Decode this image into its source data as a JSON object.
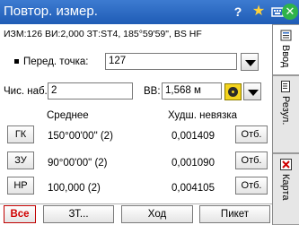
{
  "window": {
    "title": "Повтор. измер."
  },
  "titlebar_icons": {
    "help": "question-mark-icon",
    "favorite": "star-icon",
    "keyboard": "keyboard-icon",
    "close": "close-icon"
  },
  "status_line": "ИЗМ:126  ВИ:2,000  ЗТ:ST4, 185°59'59\", BS НF",
  "backsight": {
    "label": "Перед. точка:",
    "value": "127"
  },
  "sets": {
    "label": "Чис. наб.:",
    "value": "2"
  },
  "target_height": {
    "label": "ВВ:",
    "value": "1,568 м"
  },
  "table": {
    "col_mean": "Среднее",
    "col_worst": "Худш. невязка",
    "rows": [
      {
        "button": "ГК",
        "mean": "150°00'00\" (2)",
        "worst": "0,001409",
        "action": "Отб."
      },
      {
        "button": "ЗУ",
        "mean": "90°00'00\" (2)",
        "worst": "0,001090",
        "action": "Отб."
      },
      {
        "button": "НР",
        "mean": "100,000 (2)",
        "worst": "0,004105",
        "action": "Отб."
      }
    ]
  },
  "bottom_buttons": {
    "all": "Все",
    "st": "ЗТ...",
    "move": "Ход",
    "stake": "Пикет"
  },
  "side_tabs": [
    {
      "label": "Ввод",
      "icon": "input-icon"
    },
    {
      "label": "Резул.",
      "icon": "results-icon"
    },
    {
      "label": "Карта",
      "icon": "map-icon"
    }
  ],
  "colors": {
    "titlebar": "#2a68c4",
    "accent_red": "#d00000",
    "prism_yellow": "#f3d31f"
  }
}
